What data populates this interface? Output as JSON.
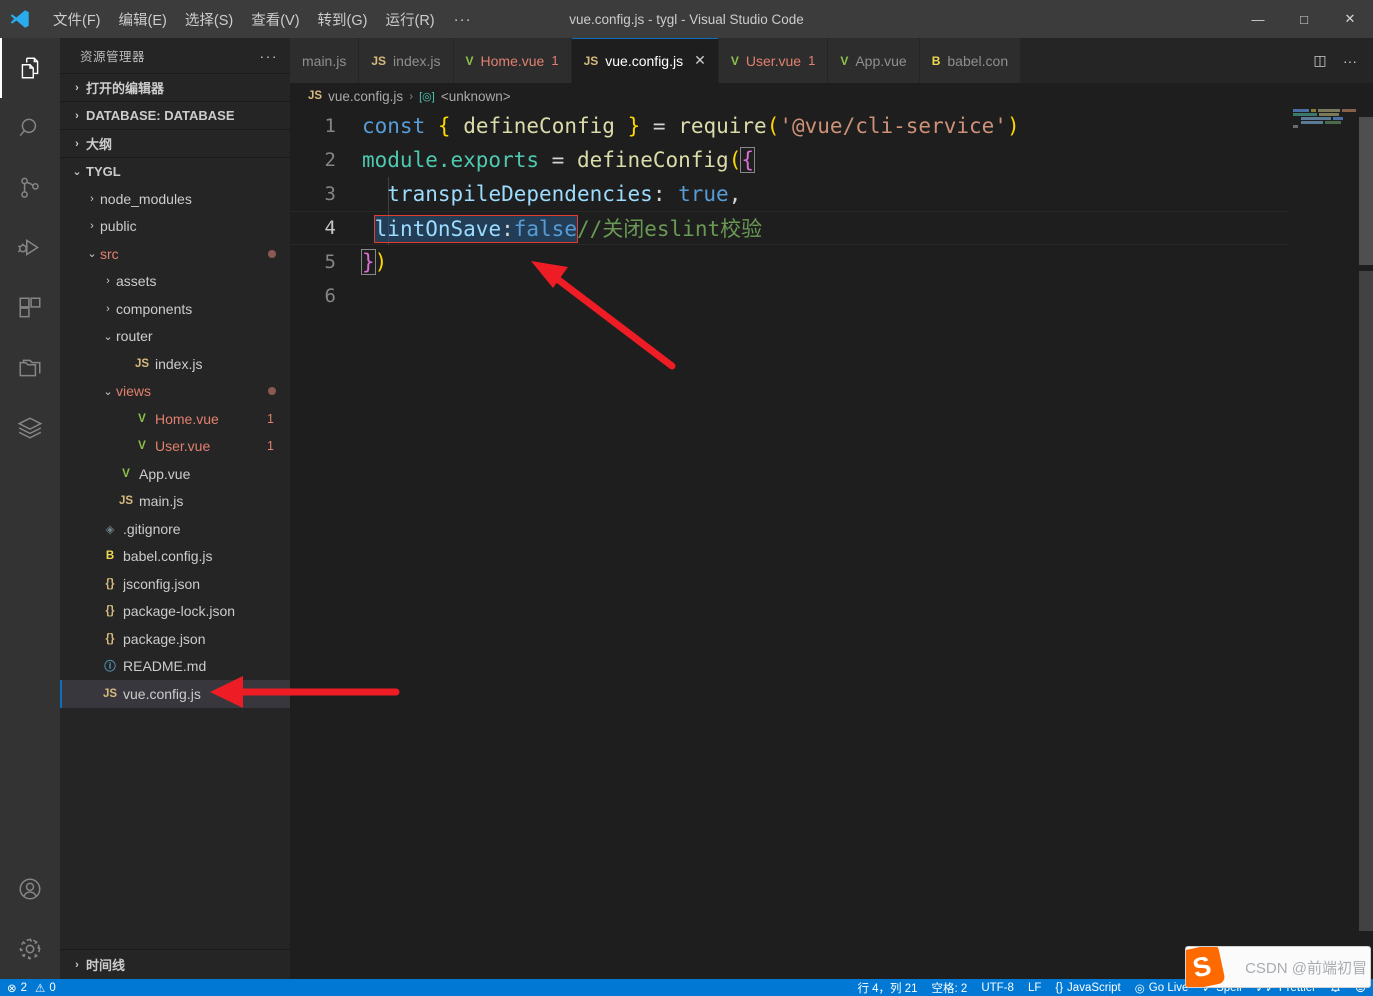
{
  "window": {
    "title": "vue.config.js - tygl - Visual Studio Code",
    "minimize": "—",
    "maximize": "□",
    "close": "✕"
  },
  "menu": {
    "items": [
      {
        "label": "文件(F)",
        "name": "menu-file"
      },
      {
        "label": "编辑(E)",
        "name": "menu-edit"
      },
      {
        "label": "选择(S)",
        "name": "menu-selection"
      },
      {
        "label": "查看(V)",
        "name": "menu-view"
      },
      {
        "label": "转到(G)",
        "name": "menu-go"
      },
      {
        "label": "运行(R)",
        "name": "menu-run"
      }
    ],
    "overflow": "···"
  },
  "activitybar": {
    "items": [
      {
        "name": "explorer-icon",
        "label": "资源管理器",
        "active": true
      },
      {
        "name": "search-icon",
        "label": "搜索",
        "active": false
      },
      {
        "name": "source-control-icon",
        "label": "源代码管理",
        "active": false
      },
      {
        "name": "run-debug-icon",
        "label": "运行和调试",
        "active": false
      },
      {
        "name": "extensions-icon",
        "label": "扩展",
        "active": false
      },
      {
        "name": "remote-explorer-icon",
        "label": "远程资源管理器",
        "active": false
      },
      {
        "name": "database-icon",
        "label": "数据库",
        "active": false
      }
    ],
    "bottom": [
      {
        "name": "accounts-icon",
        "label": "帐户"
      },
      {
        "name": "settings-gear-icon",
        "label": "管理"
      }
    ]
  },
  "sidebar": {
    "title": "资源管理器",
    "more": "···",
    "sections": [
      {
        "label": "打开的编辑器",
        "expanded": false,
        "chevron": "›"
      },
      {
        "label": "DATABASE: DATABASE",
        "expanded": false,
        "chevron": "›"
      },
      {
        "label": "大纲",
        "expanded": false,
        "chevron": "›"
      }
    ],
    "project": {
      "label": "TYGL",
      "chevron": "⌄"
    },
    "timeline": {
      "label": "时间线",
      "chevron": "›"
    },
    "tree": [
      {
        "name": "node_modules",
        "type": "folder",
        "indent": 1,
        "chevron": "›",
        "icon": "",
        "badge": "",
        "modified": false,
        "selected": false
      },
      {
        "name": "public",
        "type": "folder",
        "indent": 1,
        "chevron": "›",
        "icon": "",
        "badge": "",
        "modified": false,
        "selected": false
      },
      {
        "name": "src",
        "type": "folder",
        "indent": 1,
        "chevron": "⌄",
        "icon": "",
        "badge": "",
        "modified": true,
        "selected": false
      },
      {
        "name": "assets",
        "type": "folder",
        "indent": 2,
        "chevron": "›",
        "icon": "",
        "badge": "",
        "modified": false,
        "selected": false
      },
      {
        "name": "components",
        "type": "folder",
        "indent": 2,
        "chevron": "›",
        "icon": "",
        "badge": "",
        "modified": false,
        "selected": false
      },
      {
        "name": "router",
        "type": "folder",
        "indent": 2,
        "chevron": "⌄",
        "icon": "",
        "badge": "",
        "modified": false,
        "selected": false
      },
      {
        "name": "index.js",
        "type": "js",
        "indent": 3,
        "chevron": "",
        "icon": "JS",
        "badge": "",
        "modified": false,
        "selected": false
      },
      {
        "name": "views",
        "type": "folder",
        "indent": 2,
        "chevron": "⌄",
        "icon": "",
        "badge": "",
        "modified": true,
        "selected": false
      },
      {
        "name": "Home.vue",
        "type": "vue",
        "indent": 3,
        "chevron": "",
        "icon": "V",
        "badge": "1",
        "modified": true,
        "selected": false
      },
      {
        "name": "User.vue",
        "type": "vue",
        "indent": 3,
        "chevron": "",
        "icon": "V",
        "badge": "1",
        "modified": true,
        "selected": false
      },
      {
        "name": "App.vue",
        "type": "vue",
        "indent": 2,
        "chevron": "",
        "icon": "V",
        "badge": "",
        "modified": false,
        "selected": false
      },
      {
        "name": "main.js",
        "type": "js",
        "indent": 2,
        "chevron": "",
        "icon": "JS",
        "badge": "",
        "modified": false,
        "selected": false
      },
      {
        "name": ".gitignore",
        "type": "git",
        "indent": 1,
        "chevron": "",
        "icon": "◈",
        "badge": "",
        "modified": false,
        "selected": false
      },
      {
        "name": "babel.config.js",
        "type": "babel",
        "indent": 1,
        "chevron": "",
        "icon": "B",
        "badge": "",
        "modified": false,
        "selected": false
      },
      {
        "name": "jsconfig.json",
        "type": "json",
        "indent": 1,
        "chevron": "",
        "icon": "{}",
        "badge": "",
        "modified": false,
        "selected": false
      },
      {
        "name": "package-lock.json",
        "type": "json",
        "indent": 1,
        "chevron": "",
        "icon": "{}",
        "badge": "",
        "modified": false,
        "selected": false
      },
      {
        "name": "package.json",
        "type": "json",
        "indent": 1,
        "chevron": "",
        "icon": "{}",
        "badge": "",
        "modified": false,
        "selected": false
      },
      {
        "name": "README.md",
        "type": "md",
        "indent": 1,
        "chevron": "",
        "icon": "ⓘ",
        "badge": "",
        "modified": false,
        "selected": false
      },
      {
        "name": "vue.config.js",
        "type": "js",
        "indent": 1,
        "chevron": "",
        "icon": "JS",
        "badge": "",
        "modified": false,
        "selected": true
      }
    ]
  },
  "tabs": {
    "items": [
      {
        "label": "main.js",
        "icon": "",
        "badge": "",
        "active": false,
        "error": false,
        "close": ""
      },
      {
        "label": "index.js",
        "icon": "JS",
        "badge": "",
        "active": false,
        "error": false,
        "close": ""
      },
      {
        "label": "Home.vue",
        "icon": "V",
        "badge": "1",
        "active": false,
        "error": true,
        "close": ""
      },
      {
        "label": "vue.config.js",
        "icon": "JS",
        "badge": "",
        "active": true,
        "error": false,
        "close": "✕"
      },
      {
        "label": "User.vue",
        "icon": "V",
        "badge": "1",
        "active": false,
        "error": true,
        "close": ""
      },
      {
        "label": "App.vue",
        "icon": "V",
        "badge": "",
        "active": false,
        "error": false,
        "close": ""
      },
      {
        "label": "babel.con",
        "icon": "B",
        "badge": "",
        "active": false,
        "error": false,
        "close": ""
      }
    ],
    "actions": [
      {
        "name": "split-editor-icon",
        "glyph": "◫"
      },
      {
        "name": "more-actions-icon",
        "glyph": "···"
      }
    ]
  },
  "breadcrumb": {
    "file_icon": "JS",
    "file": "vue.config.js",
    "separator": "›",
    "symbol_icon": "[◎]",
    "symbol": "<unknown>"
  },
  "code": {
    "language": "javascript",
    "lines": [
      {
        "num": "1",
        "text": "const { defineConfig } = require('@vue/cli-service')"
      },
      {
        "num": "2",
        "text": "module.exports = defineConfig({"
      },
      {
        "num": "3",
        "text": "  transpileDependencies: true,"
      },
      {
        "num": "4",
        "text": "  lintOnSave:false//关闭eslint校验"
      },
      {
        "num": "5",
        "text": "})"
      },
      {
        "num": "6",
        "text": ""
      }
    ],
    "tokens": {
      "l1": {
        "const": "const",
        "brace_open": "{",
        "ident": "defineConfig",
        "brace_close": "}",
        "eq": "=",
        "require": "require",
        "paren_open": "(",
        "string": "'@vue/cli-service'",
        "paren_close": ")"
      },
      "l2": {
        "module_exports": "module.exports",
        "eq": "=",
        "fn": "defineConfig",
        "paren_open": "(",
        "brace": "{"
      },
      "l3": {
        "prop": "transpileDependencies",
        "colon": ":",
        "value": "true",
        "comma": ","
      },
      "l4": {
        "prop": "lintOnSave",
        "colon": ":",
        "value": "false",
        "comment": "//关闭eslint校验"
      },
      "l5": {
        "brace": "}",
        "paren": ")"
      }
    },
    "highlight_box_text": "lintOnSave:false"
  },
  "statusbar": {
    "left": [
      {
        "name": "error-count",
        "glyph": "⊗",
        "label": "2"
      },
      {
        "name": "warning-count",
        "glyph": "⚠",
        "label": "0"
      }
    ],
    "right": [
      {
        "name": "cursor-position",
        "label": "行 4，列 21",
        "glyph": ""
      },
      {
        "name": "indentation",
        "label": "空格: 2",
        "glyph": ""
      },
      {
        "name": "encoding",
        "label": "UTF-8",
        "glyph": ""
      },
      {
        "name": "eol",
        "label": "LF",
        "glyph": ""
      },
      {
        "name": "language-mode",
        "label": "JavaScript",
        "glyph": "{}"
      },
      {
        "name": "go-live",
        "label": "Go Live",
        "glyph": "◎"
      },
      {
        "name": "spell-checker",
        "label": "Spell",
        "glyph": "✓"
      },
      {
        "name": "prettier",
        "label": "Prettier",
        "glyph": "✓✓"
      },
      {
        "name": "notifications",
        "label": "",
        "glyph": "ὑ4"
      },
      {
        "name": "feedback",
        "label": "",
        "glyph": "☺"
      }
    ]
  },
  "overlay": {
    "ime_name": "sogou-ime-toolbar",
    "sogou_letter": "S",
    "watermark": "CSDN @前端初冒"
  },
  "colors": {
    "accent": "#0078d4",
    "titlebar_bg": "#3c3c3c",
    "activitybar_bg": "#333333",
    "sidebar_bg": "#252526",
    "editor_bg": "#1e1e1e",
    "tab_active_bg": "#1e1e1e",
    "tab_inactive_bg": "#2d2d2d",
    "keyword": "#569cd6",
    "function": "#dcdcaa",
    "string": "#ce9178",
    "class": "#4ec9b0",
    "property": "#9cdcfe",
    "comment": "#6a9955",
    "error_red": "#e2806e",
    "arrow_red": "#ee1c25",
    "selection_box": "#e03c31"
  }
}
